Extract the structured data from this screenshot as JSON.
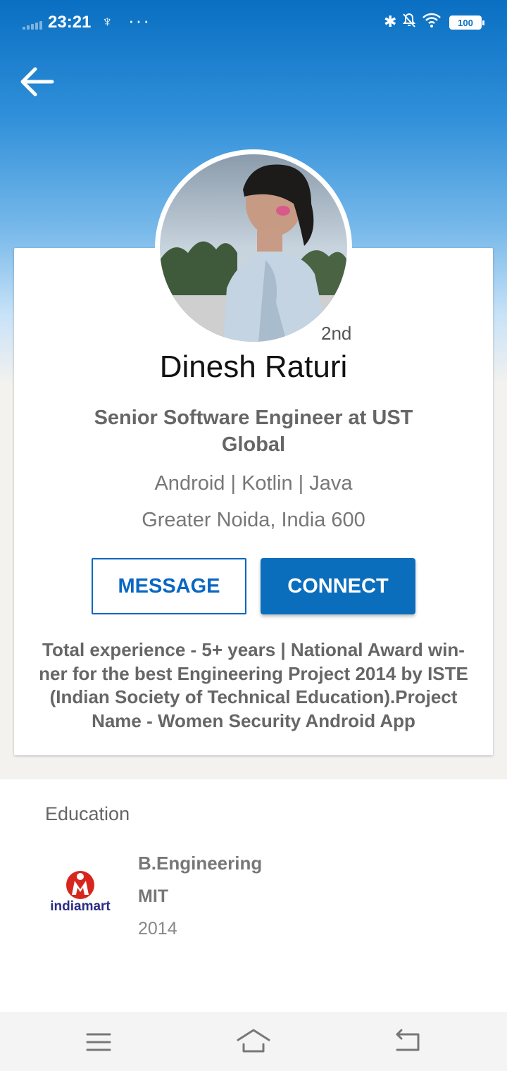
{
  "status_bar": {
    "time": "23:21",
    "usb_symbol": "♆",
    "more": "···",
    "bluetooth_symbol": "✱",
    "bell_symbol": "🔕",
    "battery": "100"
  },
  "profile": {
    "degree": "2nd",
    "name": "Dinesh Raturi",
    "headline": "Senior Software Engineer at UST Global",
    "skills": "Android | Kotlin | Java",
    "location": "Greater Noida, India 600",
    "summary": "Total experience - 5+ years | National Award win-ner for the best Engineering Project 2014 by ISTE (Indian Society of Technical Education).Project Name - Women Security Android App"
  },
  "actions": {
    "message_label": "MESSAGE",
    "connect_label": "CONNECT"
  },
  "education": {
    "section_title": "Education",
    "items": [
      {
        "degree": "B.Engineering",
        "school": "MIT",
        "year": "2014",
        "logo_text": "indiamart"
      }
    ]
  },
  "colors": {
    "accent": "#0a66c2",
    "header_top": "#0a6fc2"
  },
  "icons": [
    "back-arrow-icon",
    "usb-icon",
    "bluetooth-icon",
    "bell-off-icon",
    "wifi-icon",
    "battery-icon",
    "menu-icon",
    "home-icon",
    "back-icon"
  ]
}
